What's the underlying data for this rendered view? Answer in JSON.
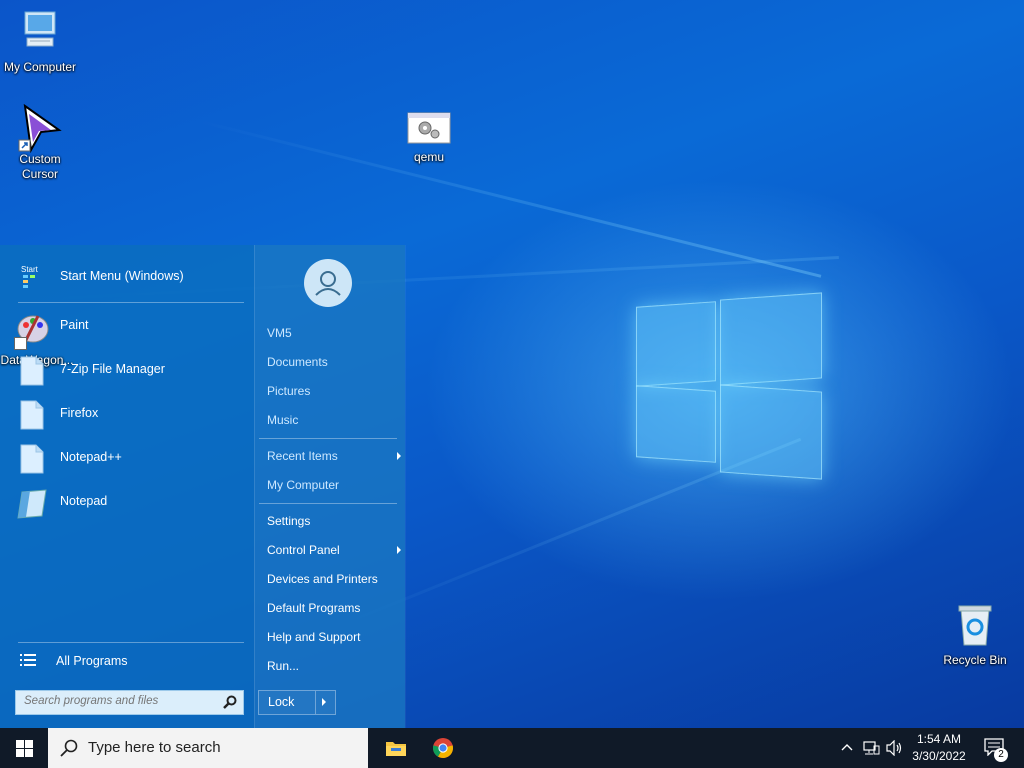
{
  "desktop": {
    "icons": [
      {
        "label": "My Computer"
      },
      {
        "label": "Custom Cursor"
      },
      {
        "label": "qemu"
      },
      {
        "label": "DataWagon..."
      },
      {
        "label": "Recycle Bin"
      }
    ]
  },
  "start_menu": {
    "programs": [
      {
        "label": "Start Menu (Windows)",
        "icon": "start-menu-icon"
      },
      {
        "label": "Paint",
        "icon": "paint-icon"
      },
      {
        "label": "7-Zip File Manager",
        "icon": "file-icon"
      },
      {
        "label": "Firefox",
        "icon": "file-icon"
      },
      {
        "label": "Notepad++",
        "icon": "file-icon"
      },
      {
        "label": "Notepad",
        "icon": "notepad-icon"
      }
    ],
    "all_programs": "All Programs",
    "search_placeholder": "Search programs and files",
    "right_items": [
      {
        "label": "VM5"
      },
      {
        "label": "Documents"
      },
      {
        "label": "Pictures"
      },
      {
        "label": "Music"
      },
      {
        "label": "Recent Items"
      },
      {
        "label": "My Computer"
      },
      {
        "label": "Settings"
      },
      {
        "label": "Control Panel"
      },
      {
        "label": "Devices and Printers"
      },
      {
        "label": "Default Programs"
      },
      {
        "label": "Help and Support"
      },
      {
        "label": "Run..."
      }
    ],
    "lock_label": "Lock"
  },
  "taskbar": {
    "search_placeholder": "Type here to search",
    "pinned": [
      "file-explorer-icon",
      "chrome-icon"
    ],
    "time": "1:54 AM",
    "date": "3/30/2022",
    "notification_count": "2"
  },
  "colors": {
    "taskbar": "#101a28",
    "start_menu": "#0a6ebe",
    "desktop_accent": "#0a6ad6"
  }
}
